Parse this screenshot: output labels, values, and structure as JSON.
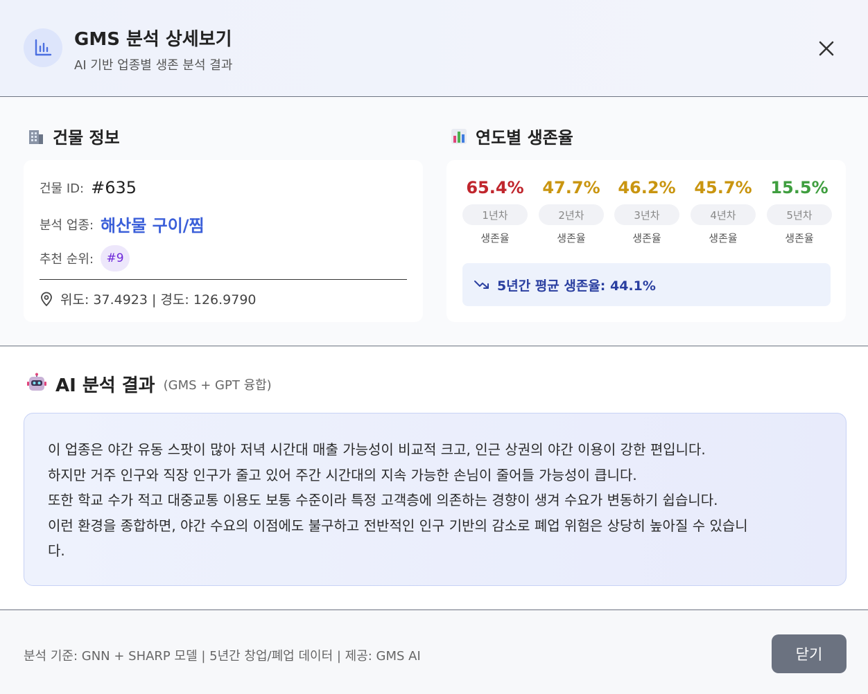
{
  "header": {
    "title": "GMS 분석 상세보기",
    "subtitle": "AI 기반 업종별 생존 분석 결과",
    "icon": "bar-chart-icon",
    "close_icon": "close-icon"
  },
  "building": {
    "section_title": "건물 정보",
    "section_icon": "building-icon",
    "id_label": "건물 ID:",
    "id_value": "#635",
    "industry_label": "분석 업종:",
    "industry_value": "해산물 구이/찜",
    "rank_label": "추천 순위:",
    "rank_value": "#9",
    "coords": "위도: 37.4923 | 경도: 126.9790",
    "location_icon": "map-pin-icon"
  },
  "survival": {
    "section_title": "연도별 생존율",
    "section_icon": "bar-chart-emoji-icon",
    "years": [
      {
        "pct": "65.4%",
        "year": "1년차",
        "label": "생존율",
        "color": "#c0262d"
      },
      {
        "pct": "47.7%",
        "year": "2년차",
        "label": "생존율",
        "color": "#c99510"
      },
      {
        "pct": "46.2%",
        "year": "3년차",
        "label": "생존율",
        "color": "#c99510"
      },
      {
        "pct": "45.7%",
        "year": "4년차",
        "label": "생존율",
        "color": "#c99510"
      },
      {
        "pct": "15.5%",
        "year": "5년차",
        "label": "생존율",
        "color": "#3f9e3f"
      }
    ],
    "average": "5년간 평균 생존율: 44.1%",
    "trend_icon": "trending-down-icon"
  },
  "ai": {
    "title": "AI 분석 결과",
    "subtitle": "(GMS + GPT 융합)",
    "icon": "robot-icon",
    "lines": [
      "이 업종은 야간 유동 스팟이 많아 저녁 시간대 매출 가능성이 비교적 크고, 인근 상권의 야간 이용이 강한 편입니다.",
      "하지만 거주 인구와 직장 인구가 줄고 있어 주간 시간대의 지속 가능한 손님이 줄어들 가능성이 큽니다.",
      "또한 학교 수가 적고 대중교통 이용도 보통 수준이라 특정 고객층에 의존하는 경향이 생겨 수요가 변동하기 쉽습니다.",
      "이런 환경을 종합하면, 야간 수요의 이점에도 불구하고 전반적인 인구 기반의 감소로 폐업 위험은 상당히 높아질 수 있습니",
      "다."
    ]
  },
  "footer": {
    "note": "분석 기준: GNN + SHARP 모델 | 5년간 창업/폐업 데이터 | 제공: GMS AI",
    "close_label": "닫기"
  }
}
